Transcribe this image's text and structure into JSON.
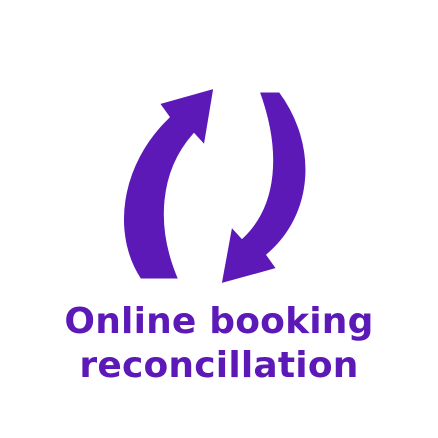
{
  "caption": {
    "line1": "Online booking",
    "line2": "reconcillation"
  },
  "icon": {
    "name": "sync-arrows-icon",
    "color": "#5c19b8",
    "stroke": "#ffffff"
  },
  "background": "#ffffff"
}
